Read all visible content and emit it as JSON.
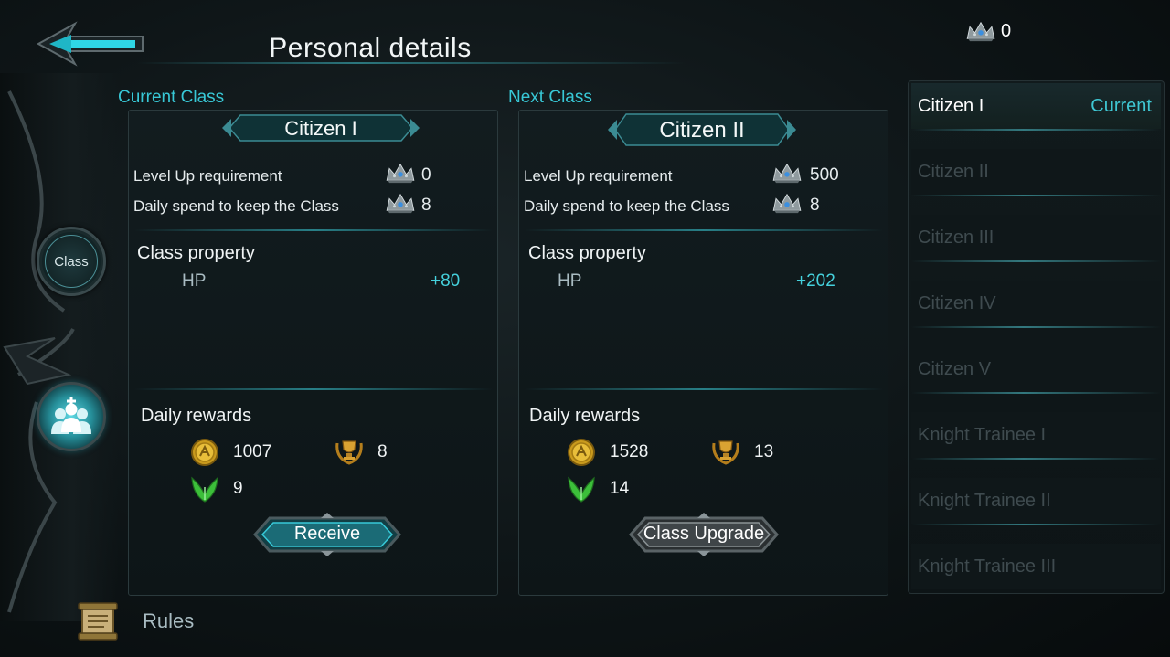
{
  "header": {
    "title": "Personal details",
    "back_icon": "back-arrow-icon",
    "currency_value": "0",
    "currency_icon": "crown-icon"
  },
  "rail": {
    "class_button_label": "Class",
    "social_icon": "people-add-icon"
  },
  "current": {
    "section_label": "Current Class",
    "class_name": "Citizen I",
    "level_up_label": "Level Up requirement",
    "level_up_value": "0",
    "daily_spend_label": "Daily spend to keep the Class",
    "daily_spend_value": "8",
    "property_title": "Class property",
    "property_name": "HP",
    "property_value": "+80",
    "rewards_title": "Daily rewards",
    "reward_coin": "1007",
    "reward_trophy": "8",
    "reward_leaf": "9",
    "button_label": "Receive"
  },
  "next": {
    "section_label": "Next Class",
    "class_name": "Citizen II",
    "level_up_label": "Level Up requirement",
    "level_up_value": "500",
    "daily_spend_label": "Daily spend to keep the Class",
    "daily_spend_value": "8",
    "property_title": "Class property",
    "property_name": "HP",
    "property_value": "+202",
    "rewards_title": "Daily rewards",
    "reward_coin": "1528",
    "reward_trophy": "13",
    "reward_leaf": "14",
    "button_label": "Class Upgrade"
  },
  "class_list": {
    "current_tag": "Current",
    "items": [
      {
        "label": "Citizen I"
      },
      {
        "label": "Citizen II"
      },
      {
        "label": "Citizen III"
      },
      {
        "label": "Citizen IV"
      },
      {
        "label": "Citizen V"
      },
      {
        "label": "Knight Trainee I"
      },
      {
        "label": "Knight Trainee II"
      },
      {
        "label": "Knight Trainee III"
      }
    ]
  },
  "footer": {
    "rules_label": "Rules",
    "rules_icon": "scroll-icon"
  },
  "colors": {
    "accent": "#38c8d6",
    "property_value": "#45d1dc",
    "inactive_text": "#3f4b4f"
  }
}
